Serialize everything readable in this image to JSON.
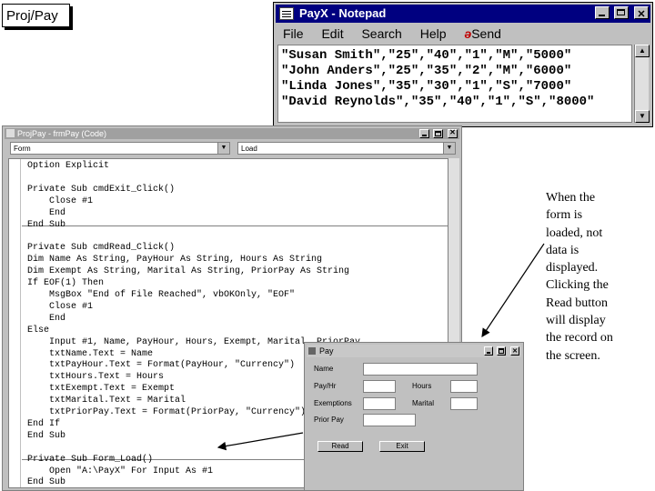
{
  "slide": {
    "title": "Proj/Pay"
  },
  "notepad": {
    "title": "PayX - Notepad",
    "menu": [
      "File",
      "Edit",
      "Search",
      "Help"
    ],
    "send_label": "Send",
    "send_icon": "send-icon",
    "lines": [
      "\"Susan Smith\",\"25\",\"40\",\"1\",\"M\",\"5000\"",
      "\"John Anders\",\"25\",\"35\",\"2\",\"M\",\"6000\"",
      "\"Linda Jones\",\"35\",\"30\",\"1\",\"S\",\"7000\"",
      "\"David Reynolds\",\"35\",\"40\",\"1\",\"S\",\"8000\""
    ]
  },
  "code_window": {
    "title": "ProjPay - frmPay (Code)",
    "object_combo": "Form",
    "procedure_combo": "Load",
    "code_lines": [
      "Option Explicit",
      "",
      "Private Sub cmdExit_Click()",
      "    Close #1",
      "    End",
      "End Sub",
      "",
      "Private Sub cmdRead_Click()",
      "Dim Name As String, PayHour As String, Hours As String",
      "Dim Exempt As String, Marital As String, PriorPay As String",
      "If EOF(1) Then",
      "    MsgBox \"End of File Reached\", vbOKOnly, \"EOF\"",
      "    Close #1",
      "    End",
      "Else",
      "    Input #1, Name, PayHour, Hours, Exempt, Marital, PriorPay",
      "    txtName.Text = Name",
      "    txtPayHour.Text = Format(PayHour, \"Currency\")",
      "    txtHours.Text = Hours",
      "    txtExempt.Text = Exempt",
      "    txtMarital.Text = Marital",
      "    txtPriorPay.Text = Format(PriorPay, \"Currency\")",
      "End If",
      "End Sub",
      "",
      "Private Sub Form_Load()",
      "    Open \"A:\\PayX\" For Input As #1",
      "End Sub"
    ]
  },
  "pay_form": {
    "title": "Pay",
    "labels": {
      "name": "Name",
      "pay_hr": "Pay/Hr",
      "hours": "Hours",
      "exemptions": "Exemptions",
      "marital": "Marital",
      "prior_pay": "Prior Pay"
    },
    "buttons": {
      "read": "Read",
      "exit": "Exit"
    }
  },
  "note": "When the form is loaded, not data is displayed. Clicking the Read button will display the record on the screen."
}
